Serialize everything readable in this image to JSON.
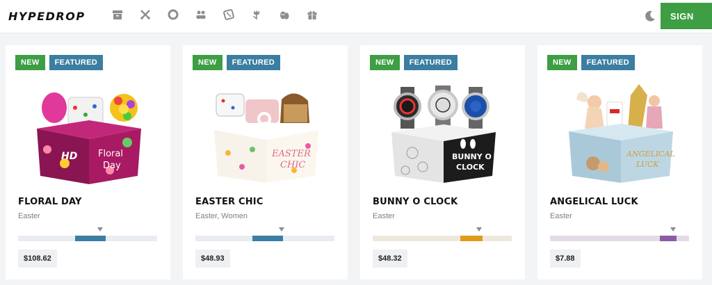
{
  "header": {
    "logo": "HYPEDROP",
    "sign_label": "SIGN",
    "nav_icons": [
      "box-icon",
      "swords-icon",
      "ring-icon",
      "users-icon",
      "dice-icon",
      "tulip-icon",
      "easter-eggs-icon",
      "gift-icon"
    ],
    "theme_icon": "moon-icon"
  },
  "colors": {
    "accent_green": "#3d9e43",
    "featured_blue": "#3b7ea1",
    "odds_blue": "#3b7ea1",
    "odds_orange": "#e09b1a",
    "odds_purple": "#8e5aa8"
  },
  "cards": [
    {
      "badge_new": "NEW",
      "badge_featured": "FEATURED",
      "title": "FLORAL DAY",
      "category": "Easter",
      "price": "$108.62",
      "box_text_1": "HD",
      "box_text_2": "Floral",
      "box_text_3": "Day"
    },
    {
      "badge_new": "NEW",
      "badge_featured": "FEATURED",
      "title": "EASTER CHIC",
      "category": "Easter, Women",
      "price": "$48.93",
      "box_text_1": "EASTER",
      "box_text_2": "CHIC"
    },
    {
      "badge_new": "NEW",
      "badge_featured": "FEATURED",
      "title": "BUNNY O CLOCK",
      "category": "Easter",
      "price": "$48.32",
      "box_text_1": "BUNNY O",
      "box_text_2": "CLOCK"
    },
    {
      "badge_new": "NEW",
      "badge_featured": "FEATURED",
      "title": "ANGELICAL LUCK",
      "category": "Easter",
      "price": "$7.88",
      "box_text_1": "ANGELICAL",
      "box_text_2": "LUCK"
    }
  ]
}
